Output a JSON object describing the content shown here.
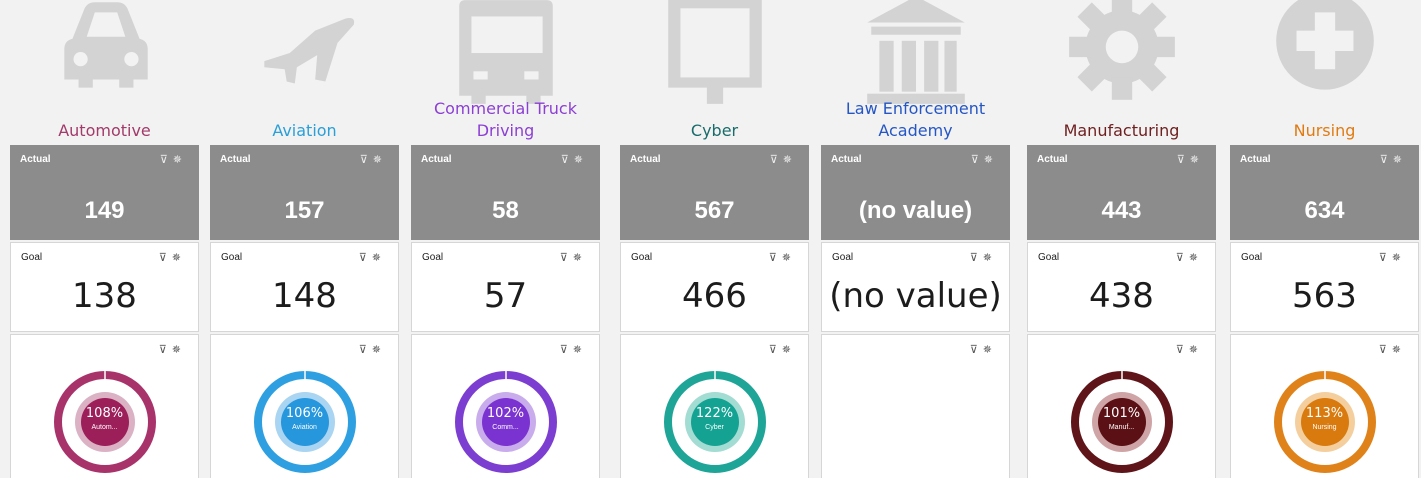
{
  "labels": {
    "actual": "Actual",
    "goal": "Goal"
  },
  "columns": [
    {
      "title": "Automotive",
      "title_color": "#a23a6a",
      "icon": "car-icon",
      "actual": "149",
      "goal": "138",
      "pct": 108,
      "pct_label": "108%",
      "short": "Autom...",
      "ring_color": "#a8336b",
      "center_color": "#9c1f5a",
      "inner_color": "#dbb1c4"
    },
    {
      "title": "Aviation",
      "title_color": "#2a9fd8",
      "icon": "airplane-icon",
      "actual": "157",
      "goal": "148",
      "pct": 106,
      "pct_label": "106%",
      "short": "Aviation",
      "ring_color": "#2e9fe0",
      "center_color": "#2696dd",
      "inner_color": "#a9d4f2"
    },
    {
      "title": "Commercial Truck Driving",
      "title_color": "#8c3fd4",
      "icon": "truck-icon",
      "actual": "58",
      "goal": "57",
      "pct": 102,
      "pct_label": "102%",
      "short": "Comm...",
      "ring_color": "#7b3ed0",
      "center_color": "#7a33d0",
      "inner_color": "#c8acec"
    },
    {
      "title": "Cyber",
      "title_color": "#1a6b6b",
      "icon": "monitor-icon",
      "actual": "567",
      "goal": "466",
      "pct": 122,
      "pct_label": "122%",
      "short": "Cyber",
      "ring_color": "#1ea597",
      "center_color": "#14a393",
      "inner_color": "#a3dcd3"
    },
    {
      "title": "Law Enforcement Academy",
      "title_color": "#2456c5",
      "icon": "courthouse-icon",
      "actual": "(no value)",
      "goal": "(no value)",
      "pct": null,
      "pct_label": "",
      "short": "",
      "ring_color": "",
      "center_color": "",
      "inner_color": ""
    },
    {
      "title": "Manufacturing",
      "title_color": "#6e1f1f",
      "icon": "gear-icon",
      "actual": "443",
      "goal": "438",
      "pct": 101,
      "pct_label": "101%",
      "short": "Manuf...",
      "ring_color": "#5e1418",
      "center_color": "#5a1014",
      "inner_color": "#cfa4a6"
    },
    {
      "title": "Nursing",
      "title_color": "#e07b12",
      "icon": "medical-cross-icon",
      "actual": "634",
      "goal": "563",
      "pct": 113,
      "pct_label": "113%",
      "short": "Nursing",
      "ring_color": "#e0821a",
      "center_color": "#d97a0e",
      "inner_color": "#f4cf9d"
    }
  ]
}
